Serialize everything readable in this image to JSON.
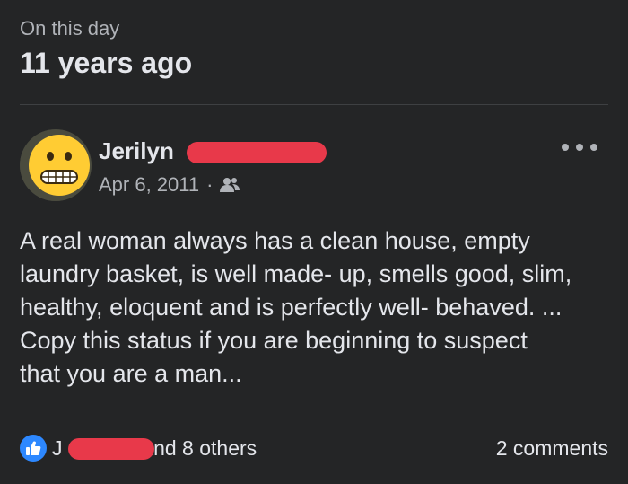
{
  "memory": {
    "label": "On this day",
    "title": "11 years ago"
  },
  "post": {
    "author_name_visible": "Jerilyn",
    "date": "Apr 6, 2011",
    "separator": "·",
    "audience_icon": "friends-icon",
    "avatar_icon": "grimacing-face-emoji",
    "more_icon": "more-options-icon",
    "body_lines": [
      "A real woman always has a clean house, empty",
      "laundry basket, is well made- up, smells good, slim,",
      "healthy, eloquent and is perfectly well- behaved. ...",
      "Copy this status if you are beginning to suspect",
      "that you are a man..."
    ]
  },
  "reactions": {
    "icon": "like-icon",
    "visible_prefix": "J",
    "suffix": "and 8 others",
    "comments": "2 comments"
  },
  "colors": {
    "background": "#242526",
    "primary_text": "#e4e6eb",
    "secondary_text": "#b0b3b8",
    "like_blue": "#2d88ff",
    "redaction": "#e8394a"
  }
}
